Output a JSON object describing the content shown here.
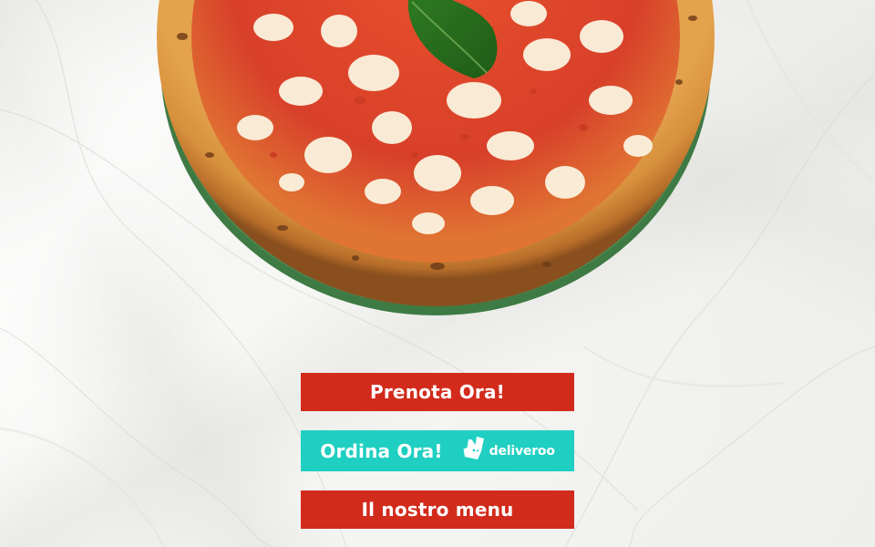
{
  "background": {
    "image": "white marble surface"
  },
  "hero": {
    "image": "margherita-pizza"
  },
  "buttons": {
    "prenota": {
      "label": "Prenota Ora!",
      "color": "#d22b1c"
    },
    "ordina": {
      "label": "Ordina Ora!",
      "color": "#1fcfc1",
      "partner_logo_text": "deliveroo",
      "partner_icon": "deliveroo-kangaroo-icon"
    },
    "menu": {
      "label": "Il nostro menu",
      "color": "#d22b1c"
    }
  }
}
